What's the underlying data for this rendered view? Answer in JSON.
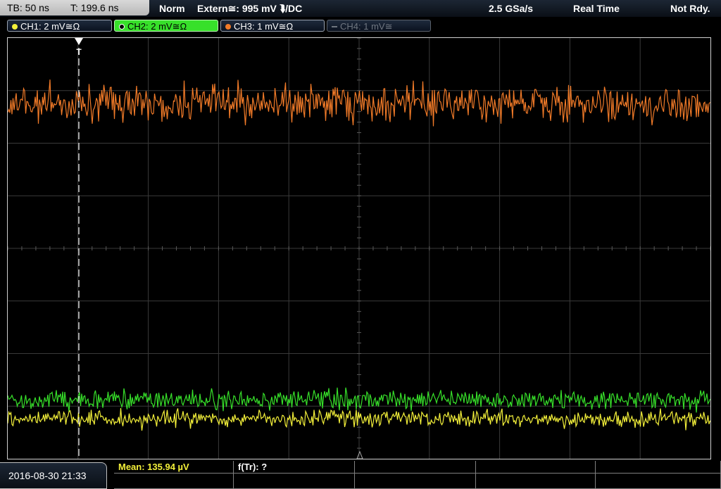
{
  "header": {
    "timebase": "TB: 50 ns",
    "trigger_time": "T: 199.6 ns",
    "mode": "Norm",
    "trigger_source": "Extern≅: 995 mV ⮯/DC",
    "sample_rate": "2.5 GSa/s",
    "acq_mode": "Real Time",
    "status": "Not Rdy."
  },
  "channels": [
    {
      "label": "CH1: 2 mV≅Ω",
      "color": "#f3f03a",
      "state": "normal"
    },
    {
      "label": "CH2: 2 mV≅Ω",
      "color": "#37e02a",
      "state": "active"
    },
    {
      "label": "CH3: 1 mV≅Ω",
      "color": "#f07a28",
      "state": "normal"
    },
    {
      "label": "CH4: 1 mV≅",
      "color": "#6f7680",
      "state": "off"
    }
  ],
  "trigger_marker": "T",
  "footer": {
    "datetime": "2016-08-30 21:33",
    "measurements": [
      {
        "label": "Mean: 135.94 µV",
        "color": "#f3f03a"
      },
      {
        "label": "f(Tr): ?",
        "color": "#ffffff"
      }
    ]
  },
  "colors": {
    "ch1": "#f3f03a",
    "ch2": "#37e02a",
    "ch3": "#f07a28",
    "grid": "#3a3a3a",
    "grid_axis": "#5a5a5a"
  }
}
